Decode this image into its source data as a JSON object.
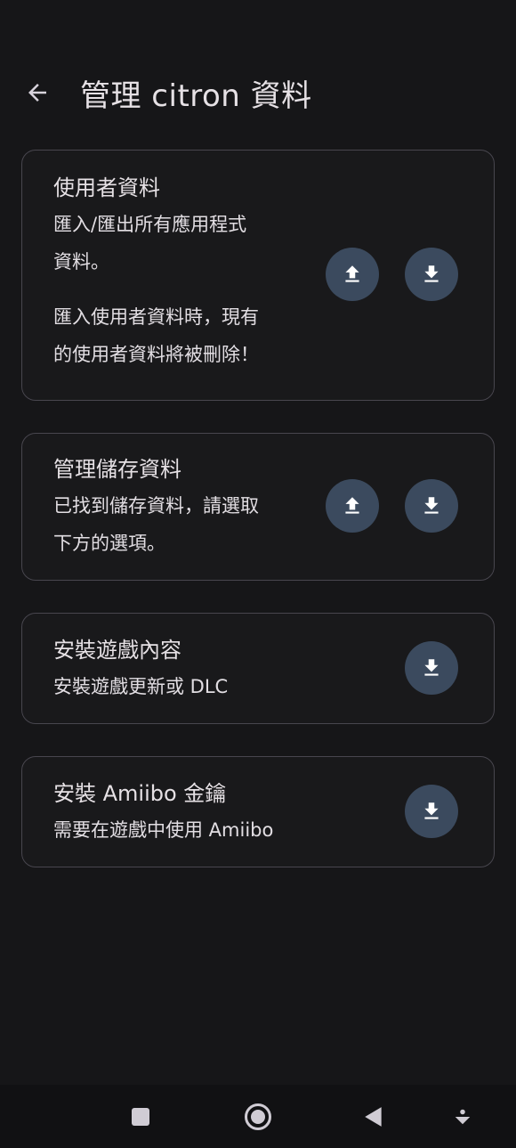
{
  "header": {
    "title": "管理 citron 資料"
  },
  "cards": [
    {
      "title": "使用者資料",
      "description_lines": [
        "匯入/匯出所有應用程式",
        "資料。"
      ],
      "warning_lines": [
        "匯入使用者資料時，現有",
        "的使用者資料將被刪除！"
      ],
      "actions": [
        "upload-icon",
        "download-icon"
      ]
    },
    {
      "title": "管理儲存資料",
      "description_lines": [
        "已找到儲存資料，請選取",
        "下方的選項。"
      ],
      "actions": [
        "upload-icon",
        "download-icon"
      ]
    },
    {
      "title": "安裝遊戲內容",
      "description_lines": [
        "安裝遊戲更新或 DLC"
      ],
      "actions": [
        "download-icon"
      ]
    },
    {
      "title": "安裝 Amiibo 金鑰",
      "description_lines": [
        "需要在遊戲中使用 Amiibo"
      ],
      "actions": [
        "download-icon"
      ]
    }
  ],
  "colors": {
    "background": "#161618",
    "card_border": "#48464e",
    "fab": "#3b4a5e",
    "icon": "#ffffff",
    "text": "#e6e1e5"
  },
  "navbar": {
    "icons": [
      "recents-square-icon",
      "home-circle-icon",
      "back-triangle-icon",
      "hide-nav-icon"
    ]
  }
}
